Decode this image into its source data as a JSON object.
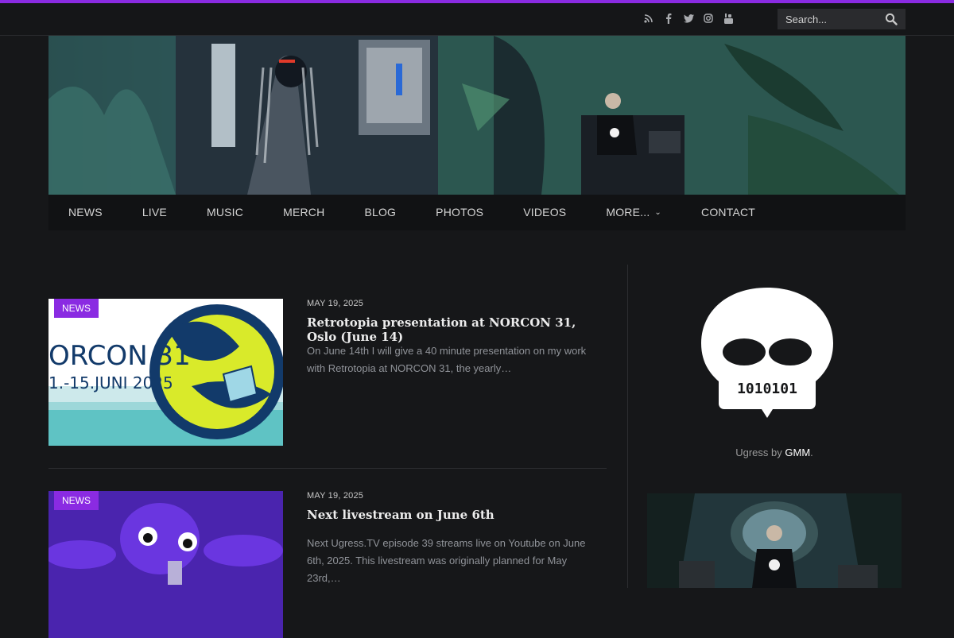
{
  "social_icons": [
    "rss-icon",
    "facebook-icon",
    "twitter-icon",
    "instagram-icon",
    "youtube-icon"
  ],
  "search": {
    "placeholder": "Search..."
  },
  "nav": {
    "items": [
      "NEWS",
      "LIVE",
      "MUSIC",
      "MERCH",
      "BLOG",
      "PHOTOS",
      "VIDEOS",
      "MORE...",
      "CONTACT"
    ]
  },
  "posts": [
    {
      "category": "NEWS",
      "date": "MAY 19, 2025",
      "title": "Retrotopia presentation at NORCON 31, Oslo (June 14)",
      "excerpt": "On June 14th I will give a 40 minute presentation on my work with Retrotopia at NORCON 31, the yearly…",
      "thumb_text_1": "ORCON 31",
      "thumb_text_2": "1.-15.JUNI 2025"
    },
    {
      "category": "NEWS",
      "date": "MAY 19, 2025",
      "title": "Next livestream on June 6th",
      "excerpt": "Next Ugress.TV episode 39 streams live on Youtube on June 6th, 2025. This livestream was originally planned for May 23rd,…"
    }
  ],
  "sidebar": {
    "logo_text": "1010101",
    "credit_prefix": "Ugress by",
    "credit_link": "GMM",
    "credit_suffix": "."
  },
  "colors": {
    "accent": "#8a2be2",
    "background": "#161719"
  }
}
